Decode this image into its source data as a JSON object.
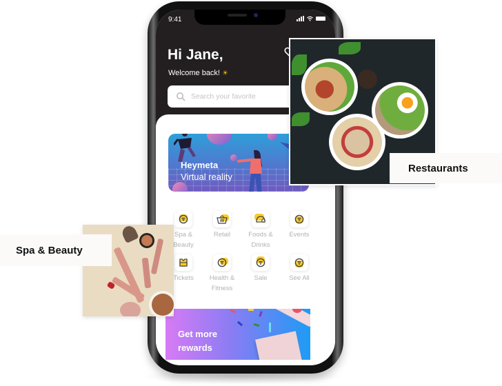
{
  "status_bar": {
    "time": "9:41",
    "icons": [
      "signal-icon",
      "wifi-icon",
      "battery-icon"
    ]
  },
  "header": {
    "greeting": "Hi Jane,",
    "welcome": "Welcome back!",
    "welcome_emoji": "☀",
    "favorite_icon": "heart-icon"
  },
  "search": {
    "placeholder": "Search your favorite",
    "icon": "search-icon"
  },
  "promo_banner": {
    "title": "Heymeta",
    "subtitle": "Virtual reality"
  },
  "categories": [
    {
      "label": "Spa & Beauty",
      "icon": "spa-icon"
    },
    {
      "label": "Retail",
      "icon": "basket-icon"
    },
    {
      "label": "Foods & Drinks",
      "icon": "taco-icon"
    },
    {
      "label": "Events",
      "icon": "filter-icon"
    },
    {
      "label": "Tickets",
      "icon": "ticket-icon"
    },
    {
      "label": "Health & Fitness",
      "icon": "filter-icon"
    },
    {
      "label": "Sale",
      "icon": "filter-icon"
    },
    {
      "label": "See All",
      "icon": "filter-icon"
    }
  ],
  "rewards_banner": {
    "line1": "Get more",
    "line2": "rewards"
  },
  "floating_cards": {
    "restaurants": {
      "label": "Restaurants"
    },
    "spa_beauty": {
      "label": "Spa & Beauty"
    }
  },
  "colors": {
    "accent_yellow": "#f8cc2e",
    "dark_header": "#231f20"
  }
}
